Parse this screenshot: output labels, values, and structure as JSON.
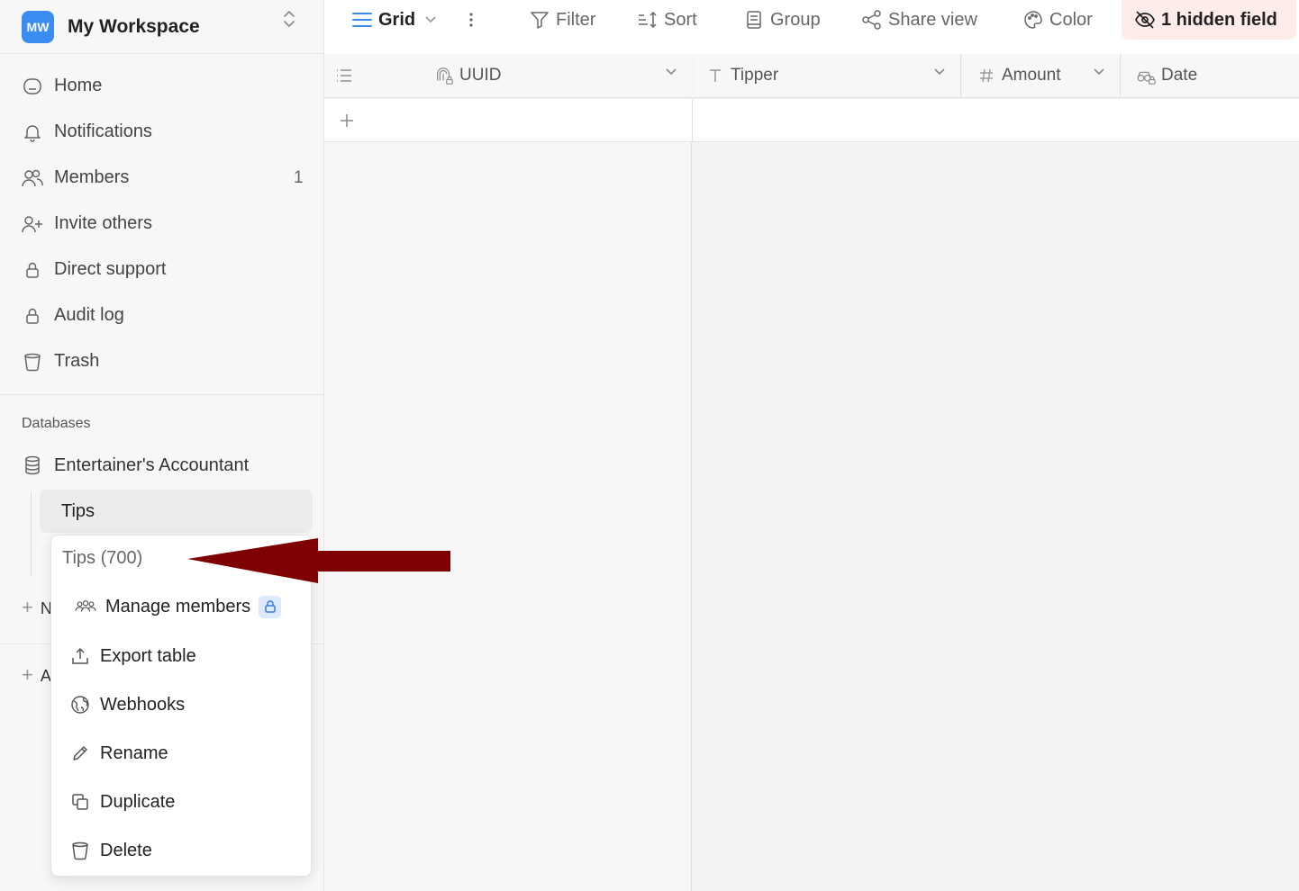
{
  "workspace": {
    "initials": "MW",
    "name": "My Workspace"
  },
  "sidebar": {
    "items": [
      {
        "label": "Home",
        "icon": "home-icon"
      },
      {
        "label": "Notifications",
        "icon": "bell-icon"
      },
      {
        "label": "Members",
        "icon": "members-icon",
        "count": "1"
      },
      {
        "label": "Invite others",
        "icon": "user-plus-icon"
      },
      {
        "label": "Direct support",
        "icon": "lock-icon"
      },
      {
        "label": "Audit log",
        "icon": "lock-icon"
      },
      {
        "label": "Trash",
        "icon": "trash-icon"
      }
    ],
    "databases_heading": "Databases",
    "database": {
      "label": "Entertainer's Accountant",
      "icon": "database-icon"
    },
    "table": {
      "label": "Tips"
    },
    "add_partial_1": "N",
    "add_partial_2": "A"
  },
  "toolbar": {
    "view_label": "Grid",
    "filter_label": "Filter",
    "sort_label": "Sort",
    "group_label": "Group",
    "share_label": "Share view",
    "color_label": "Color",
    "hidden_label": "1 hidden field",
    "hidden_bg": "#fdecea"
  },
  "grid": {
    "columns": [
      {
        "label": "UUID",
        "icon": "uuid-lock-icon"
      },
      {
        "label": "Tipper",
        "icon": "text-type-icon"
      },
      {
        "label": "Amount",
        "icon": "hash-icon"
      },
      {
        "label": "Date",
        "icon": "date-lock-icon"
      }
    ]
  },
  "context_menu": {
    "title": "Tips (700)",
    "items": [
      {
        "label": "Manage members",
        "icon": "members-icon",
        "locked": true
      },
      {
        "label": "Export table",
        "icon": "upload-icon"
      },
      {
        "label": "Webhooks",
        "icon": "globe-icon"
      },
      {
        "label": "Rename",
        "icon": "pencil-icon"
      },
      {
        "label": "Duplicate",
        "icon": "duplicate-icon"
      },
      {
        "label": "Delete",
        "icon": "trash-icon"
      }
    ]
  },
  "colors": {
    "accent": "#3b8cf0",
    "annotation_arrow": "#7e0000"
  }
}
